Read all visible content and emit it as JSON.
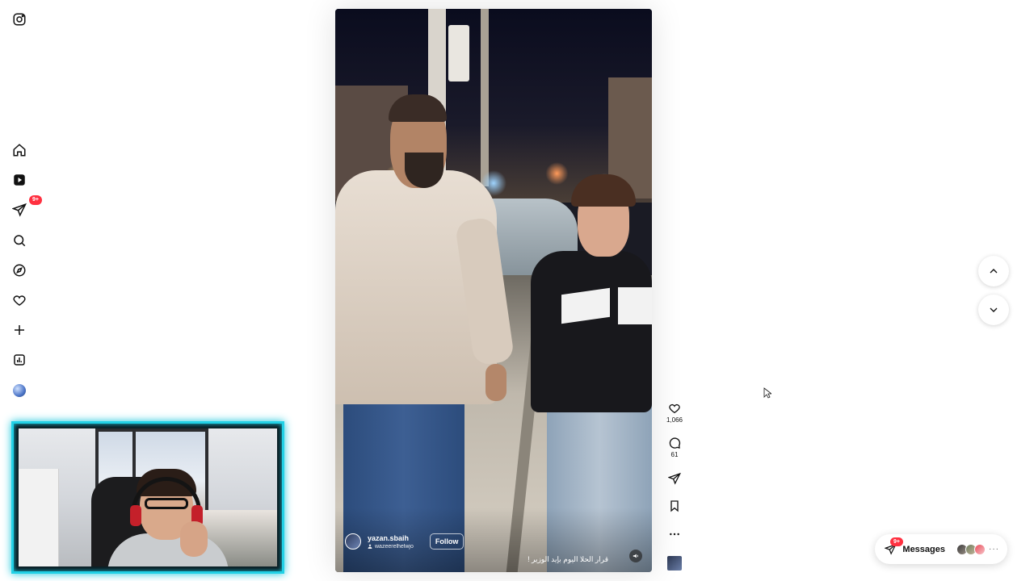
{
  "nav": {
    "items": [
      {
        "name": "instagram-icon"
      },
      {
        "name": "home-icon"
      },
      {
        "name": "reels-icon"
      },
      {
        "name": "direct-icon",
        "badge": "9+"
      },
      {
        "name": "search-icon"
      },
      {
        "name": "explore-icon"
      },
      {
        "name": "notifications-icon"
      },
      {
        "name": "create-icon"
      },
      {
        "name": "dashboard-icon"
      },
      {
        "name": "profile-avatar"
      }
    ]
  },
  "reel": {
    "username": "yazan.sbaih",
    "audio": "wazeerelhelwjo",
    "follow_label": "Follow",
    "caption": "قرار الحلا اليوم بإيد الوزير !"
  },
  "actions": {
    "likes": "1,066",
    "comments": "61"
  },
  "messages": {
    "label": "Messages",
    "badge": "9+",
    "more": "···"
  },
  "colors": {
    "accent_badge": "#ff3040",
    "webcam_border": "#22d1e6"
  }
}
